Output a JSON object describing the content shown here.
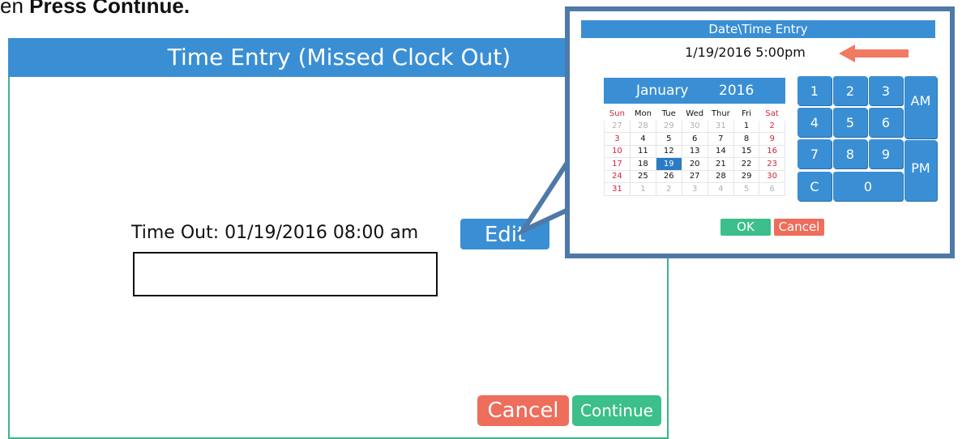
{
  "instruction": {
    "prefix": "en ",
    "bold": "Press Continue."
  },
  "main_dialog": {
    "title": "Time Entry (Missed Clock Out)",
    "time_out_label": "Time Out: 01/19/2016 08:00 am",
    "time_input_value": "",
    "edit_label": "Edit",
    "cancel_label": "Cancel",
    "continue_label": "Continue"
  },
  "popup": {
    "title": "Date\\Time Entry",
    "datetime_value": "1/19/2016 5:00pm",
    "arrow_icon": "left-arrow-icon",
    "calendar": {
      "month": "January",
      "year": "2016",
      "weekdays": [
        "Sun",
        "Mon",
        "Tue",
        "Wed",
        "Thur",
        "Fri",
        "Sat"
      ],
      "weeks": [
        [
          "27",
          "28",
          "29",
          "30",
          "31",
          "1",
          "2"
        ],
        [
          "3",
          "4",
          "5",
          "6",
          "7",
          "8",
          "9"
        ],
        [
          "10",
          "11",
          "12",
          "13",
          "14",
          "15",
          "16"
        ],
        [
          "17",
          "18",
          "19",
          "20",
          "21",
          "22",
          "23"
        ],
        [
          "24",
          "25",
          "26",
          "27",
          "28",
          "29",
          "30"
        ],
        [
          "31",
          "1",
          "2",
          "3",
          "4",
          "5",
          "6"
        ]
      ],
      "selected_day": "19"
    },
    "keypad": {
      "k1": "1",
      "k2": "2",
      "k3": "3",
      "k4": "4",
      "k5": "5",
      "k6": "6",
      "k7": "7",
      "k8": "8",
      "k9": "9",
      "clear": "C",
      "k0": "0",
      "am": "AM",
      "pm": "PM"
    },
    "ok_label": "OK",
    "cancel_label": "Cancel"
  },
  "colors": {
    "header_blue": "#3a8fd4",
    "cancel_red": "#ee6d5b",
    "continue_green": "#3cbf8a",
    "callout_border": "#4e79a8",
    "arrow": "#f07a62"
  }
}
